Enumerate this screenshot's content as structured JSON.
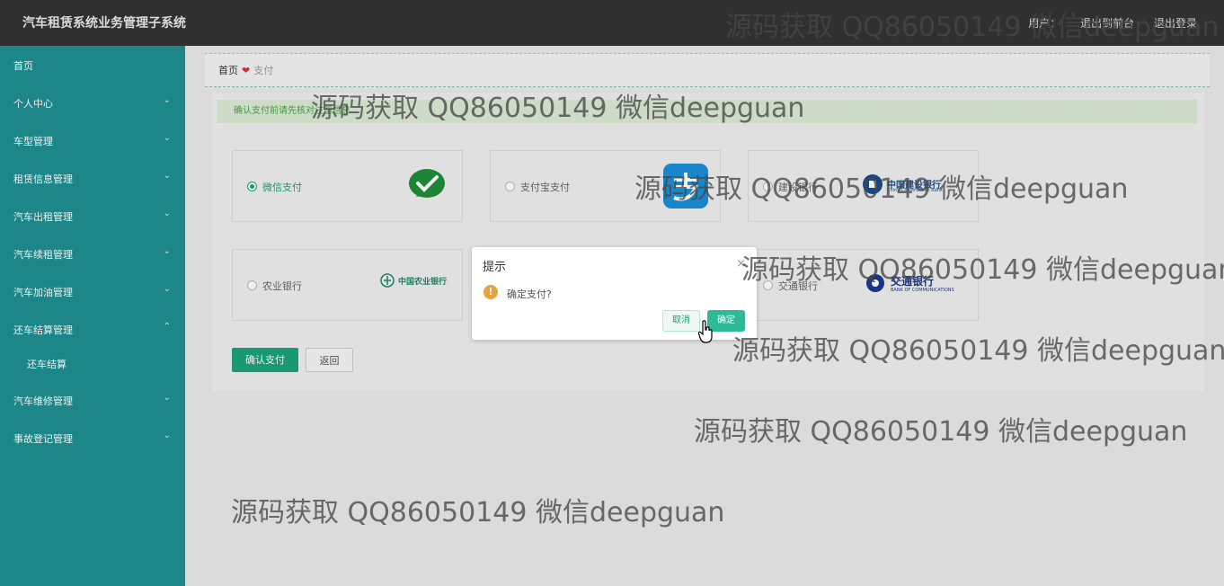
{
  "header": {
    "app_title": "汽车租赁系统业务管理子系统",
    "links": [
      "用户：",
      "退出到前台",
      "退出登录"
    ]
  },
  "sidebar": {
    "items": [
      {
        "label": "首页",
        "chevron": ""
      },
      {
        "label": "个人中心",
        "chevron": "⌄"
      },
      {
        "label": "车型管理",
        "chevron": "⌄"
      },
      {
        "label": "租赁信息管理",
        "chevron": "⌄"
      },
      {
        "label": "汽车出租管理",
        "chevron": "⌄"
      },
      {
        "label": "汽车续租管理",
        "chevron": "⌄"
      },
      {
        "label": "汽车加油管理",
        "chevron": "⌄"
      },
      {
        "label": "还车结算管理",
        "chevron": "⌃"
      },
      {
        "label": "还车结算",
        "chevron": ""
      },
      {
        "label": "汽车维修管理",
        "chevron": "⌄"
      },
      {
        "label": "事故登记管理",
        "chevron": "⌄"
      }
    ]
  },
  "breadcrumb": {
    "home": "首页",
    "separator": "❤",
    "current": "支付"
  },
  "notice": "确认支付前请先核对注册信息",
  "payment_options": [
    {
      "label": "微信支付",
      "selected": true,
      "logo": "wechat-logo"
    },
    {
      "label": "支付宝支付",
      "selected": false,
      "logo": "alipay-logo"
    },
    {
      "label": "建设银行",
      "selected": false,
      "logo": "ccb-logo",
      "logo_text": "中国建设银行",
      "logo_sub": "China Construction Bank"
    },
    {
      "label": "农业银行",
      "selected": false,
      "logo": "abc-logo",
      "logo_text": "中国农业银行"
    },
    {
      "label": "交通银行",
      "selected": false,
      "logo": "bocom-logo",
      "logo_text": "交通银行",
      "logo_sub": "BANK OF COMMUNICATIONS"
    }
  ],
  "buttons": {
    "confirm": "确认支付",
    "back": "返回"
  },
  "dialog": {
    "title": "提示",
    "close": "×",
    "warn_icon": "!",
    "message": "确定支付?",
    "cancel": "取消",
    "ok": "确定"
  },
  "watermark": "源码获取 QQ86050149 微信deepguan",
  "colors": {
    "sidebar": "#1e8f91",
    "topbar": "#333333",
    "primary": "#1aa37a",
    "warning": "#e6a23c"
  }
}
